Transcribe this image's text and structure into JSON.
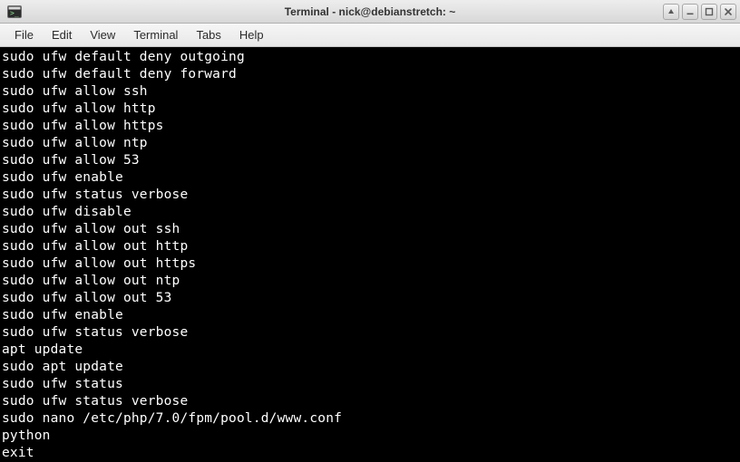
{
  "window": {
    "title": "Terminal - nick@debianstretch: ~"
  },
  "menubar": {
    "items": [
      "File",
      "Edit",
      "View",
      "Terminal",
      "Tabs",
      "Help"
    ]
  },
  "terminal": {
    "lines": [
      "sudo ufw default deny outgoing",
      "sudo ufw default deny forward",
      "sudo ufw allow ssh",
      "sudo ufw allow http",
      "sudo ufw allow https",
      "sudo ufw allow ntp",
      "sudo ufw allow 53",
      "sudo ufw enable",
      "sudo ufw status verbose",
      "sudo ufw disable",
      "sudo ufw allow out ssh",
      "sudo ufw allow out http",
      "sudo ufw allow out https",
      "sudo ufw allow out ntp",
      "sudo ufw allow out 53",
      "sudo ufw enable",
      "sudo ufw status verbose",
      "apt update",
      "sudo apt update",
      "sudo ufw status",
      "sudo ufw status verbose",
      "sudo nano /etc/php/7.0/fpm/pool.d/www.conf",
      "python",
      "exit"
    ]
  }
}
